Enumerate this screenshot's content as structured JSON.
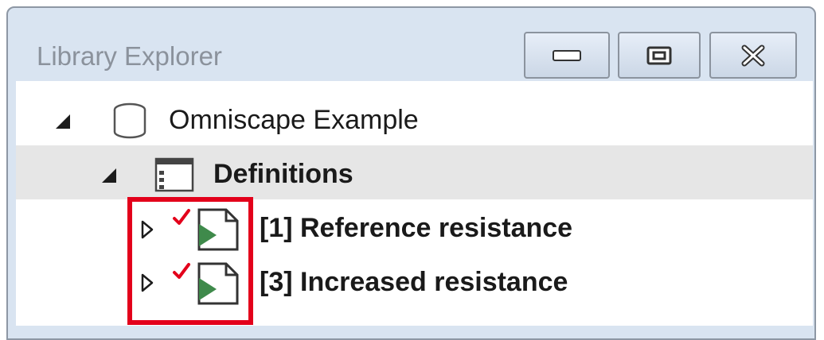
{
  "window": {
    "title": "Library Explorer"
  },
  "tree": {
    "library": {
      "label": "Omniscape Example",
      "icon": "database-icon",
      "expanded": true
    },
    "definitions": {
      "label": "Definitions",
      "icon": "definitions-icon",
      "expanded": true,
      "selected": true
    },
    "scenarios": [
      {
        "label": "[1] Reference resistance",
        "icon": "scenario-icon",
        "status": "checkmark-icon"
      },
      {
        "label": "[3] Increased resistance",
        "icon": "scenario-icon",
        "status": "checkmark-icon"
      }
    ]
  },
  "colors": {
    "titlebar": "#d9e4f1",
    "highlight_border": "#e3001b",
    "selected_row": "#e6e6e6",
    "checkmark": "#e3001b",
    "scenario_arrow": "#3f8a4b"
  }
}
